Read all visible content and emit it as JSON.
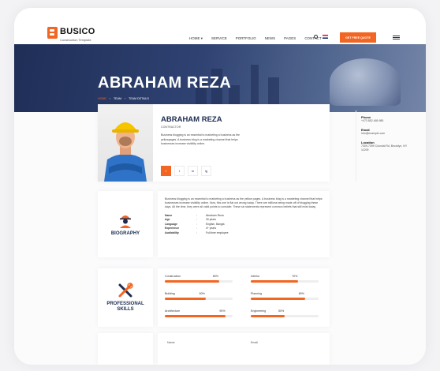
{
  "brand": {
    "name": "BUSICO",
    "tagline": "Construction Template"
  },
  "nav": {
    "items": [
      "HOME ▾",
      "SERVICE",
      "PORTFOLIO",
      "NEWS",
      "PAGES",
      "CONTACT"
    ],
    "quote_button": "GET FREE QUOTE"
  },
  "hero": {
    "title": "ABRAHAM REZA",
    "breadcrumb": [
      "HOME",
      "›",
      "TEAM",
      "›",
      "TEAM DETAILS"
    ]
  },
  "profile": {
    "name": "ABRAHAM REZA",
    "role": "CONTRACTOR",
    "intro": "Business blogging is an essential to marketing a business as the yellowpages. A business blog is a marketing channel that helps businesses increase visibility online.",
    "socials": [
      "f",
      "t",
      "in",
      "ig"
    ],
    "contact": [
      {
        "label": "Phone",
        "value": "+473 852 465 985"
      },
      {
        "label": "Email",
        "value": "Info@example.com"
      },
      {
        "label": "Location",
        "value": "7309-7399 Colonial Rd, Brooklyn, NY 11209"
      }
    ]
  },
  "biography": {
    "title": "BIOGRAPHY",
    "text": "Business blogging is an essential to marketing a business as the yellow pages. A business blog is a marketing channel that helps businesses increase visibility online. Now, this one is flat out wrong today. There are millions being made off of blogging these days. All the time, they were all valid points to consider. These six statements represent common beliefs that still exist today.",
    "info": [
      {
        "key": "Name",
        "value": "Abraham Reza"
      },
      {
        "key": "Age",
        "value": "30 years"
      },
      {
        "key": "Language",
        "value": "English, Bangla"
      },
      {
        "key": "Experience",
        "value": "4+ years"
      },
      {
        "key": "Availability",
        "value": "Full time employee"
      }
    ]
  },
  "skills": {
    "title": "PROFESSIONAL SKILLS",
    "items": [
      {
        "name": "Construction",
        "percent": 80
      },
      {
        "name": "Interior",
        "percent": 70
      },
      {
        "name": "Building",
        "percent": 60
      },
      {
        "name": "Planning",
        "percent": 80
      },
      {
        "name": "Architecture",
        "percent": 90
      },
      {
        "name": "Engineering",
        "percent": 50
      }
    ]
  },
  "bottom": {
    "labels": [
      "Name",
      "Email"
    ]
  },
  "colors": {
    "accent": "#f26522",
    "navy": "#1c2b50"
  }
}
